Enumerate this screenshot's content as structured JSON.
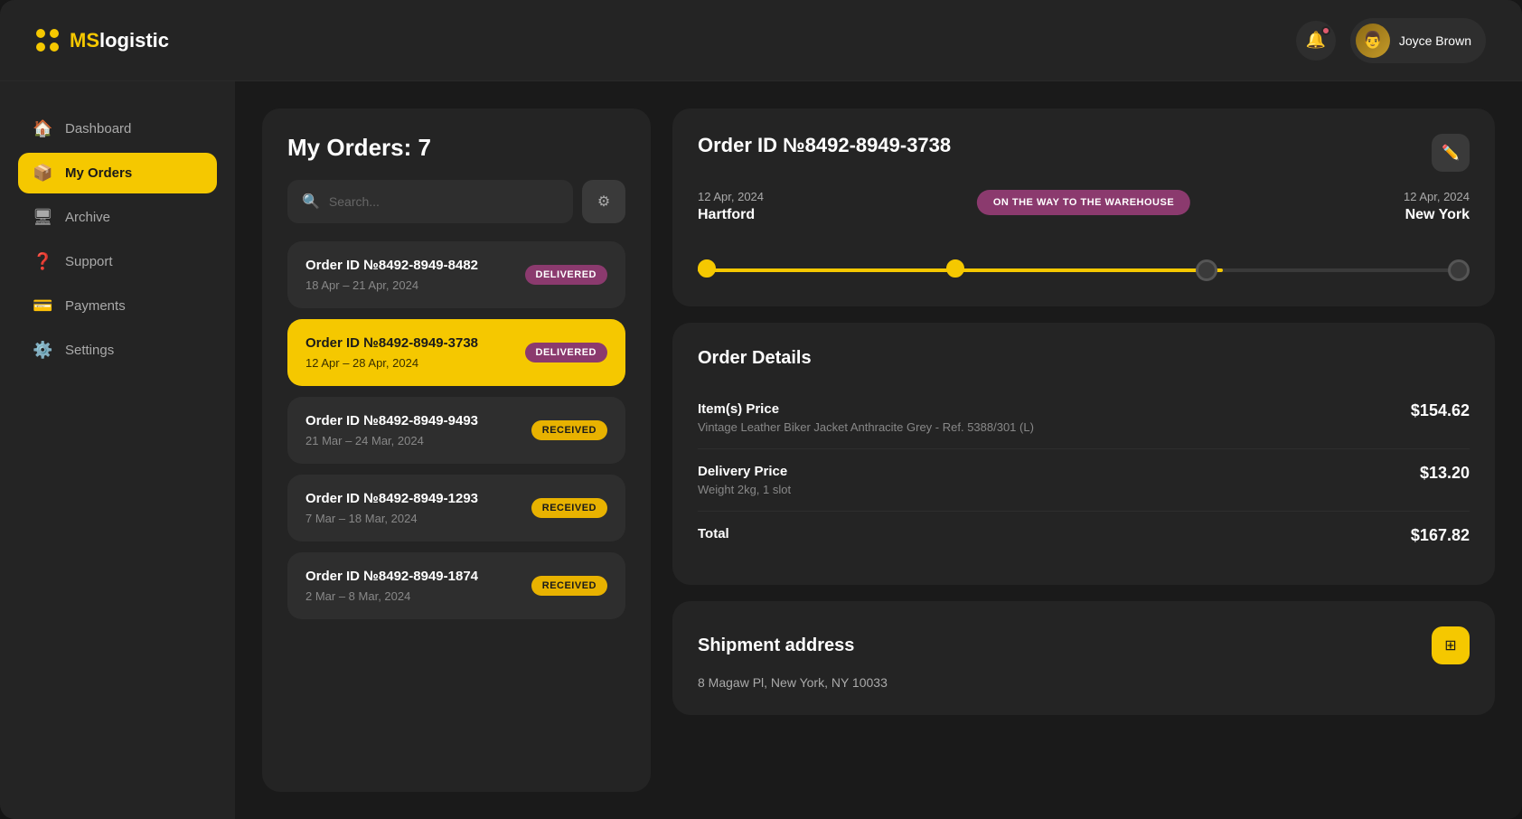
{
  "app": {
    "name": "MSlogistic",
    "name_prefix": "MS",
    "name_suffix": "logistic"
  },
  "header": {
    "user_name": "Joyce Brown"
  },
  "sidebar": {
    "items": [
      {
        "id": "dashboard",
        "label": "Dashboard",
        "icon": "🏠",
        "active": false
      },
      {
        "id": "my-orders",
        "label": "My Orders",
        "icon": "📦",
        "active": true
      },
      {
        "id": "archive",
        "label": "Archive",
        "icon": "🖥",
        "active": false
      },
      {
        "id": "support",
        "label": "Support",
        "icon": "❓",
        "active": false
      },
      {
        "id": "payments",
        "label": "Payments",
        "icon": "💳",
        "active": false
      },
      {
        "id": "settings",
        "label": "Settings",
        "icon": "⚙️",
        "active": false
      }
    ]
  },
  "orders_panel": {
    "title": "My Orders:",
    "count": "7",
    "search_placeholder": "Search...",
    "orders": [
      {
        "id": "Order ID №8492-8949-8482",
        "date_range": "18 Apr – 21 Apr, 2024",
        "status": "DELIVERED",
        "status_type": "delivered",
        "active": false
      },
      {
        "id": "Order ID №8492-8949-3738",
        "date_range": "12 Apr – 28 Apr, 2024",
        "status": "DELIVERED",
        "status_type": "delivered",
        "active": true
      },
      {
        "id": "Order ID №8492-8949-9493",
        "date_range": "21 Mar – 24 Mar, 2024",
        "status": "RECEIVED",
        "status_type": "received",
        "active": false
      },
      {
        "id": "Order ID №8492-8949-1293",
        "date_range": "7 Mar – 18 Mar, 2024",
        "status": "RECEIVED",
        "status_type": "received",
        "active": false
      },
      {
        "id": "Order ID №8492-8949-1874",
        "date_range": "2 Mar – 8 Mar, 2024",
        "status": "RECEIVED",
        "status_type": "received",
        "active": false
      }
    ]
  },
  "detail": {
    "order_id": "Order ID №8492-8949-3738",
    "tracking": {
      "origin_date": "12 Apr, 2024",
      "origin_city": "Hartford",
      "status": "ON THE WAY TO THE WAREHOUSE",
      "dest_date": "12 Apr, 2024",
      "dest_city": "New York",
      "progress_pct": 68
    },
    "order_details": {
      "title": "Order Details",
      "items_price_label": "Item(s) Price",
      "items_price_desc": "Vintage Leather Biker Jacket Anthracite Grey - Ref. 5388/301 (L)",
      "items_price_value": "$154.62",
      "delivery_price_label": "Delivery Price",
      "delivery_price_desc": "Weight 2kg, 1 slot",
      "delivery_price_value": "$13.20",
      "total_label": "Total",
      "total_value": "$167.82"
    },
    "shipment": {
      "title": "Shipment address",
      "address": "8 Magaw Pl, New York, NY 10033"
    }
  }
}
